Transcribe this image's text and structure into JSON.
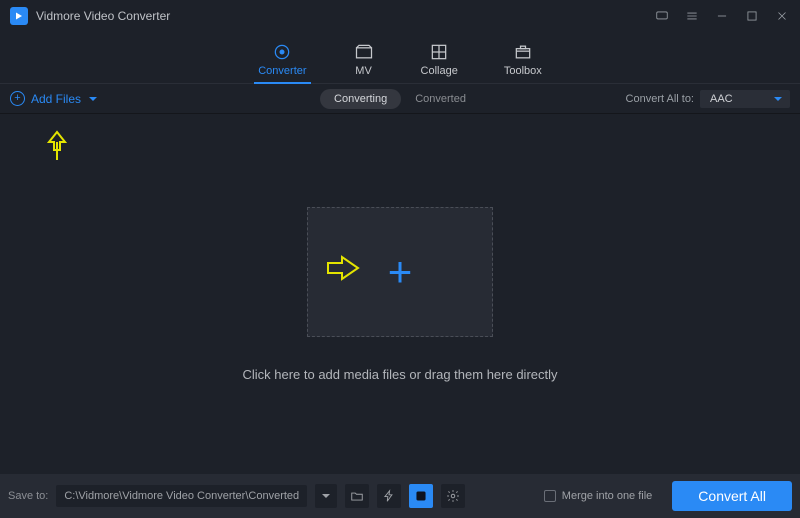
{
  "app": {
    "title": "Vidmore Video Converter"
  },
  "nav": {
    "converter": "Converter",
    "mv": "MV",
    "collage": "Collage",
    "toolbox": "Toolbox"
  },
  "toolbar": {
    "add_files": "Add Files",
    "seg_converting": "Converting",
    "seg_converted": "Converted",
    "convert_all_label": "Convert All to:",
    "format_selected": "AAC"
  },
  "dropzone": {
    "hint": "Click here to add media files or drag them here directly"
  },
  "footer": {
    "save_to_label": "Save to:",
    "save_path": "C:\\Vidmore\\Vidmore Video Converter\\Converted",
    "merge_label": "Merge into one file",
    "convert_button": "Convert All"
  }
}
